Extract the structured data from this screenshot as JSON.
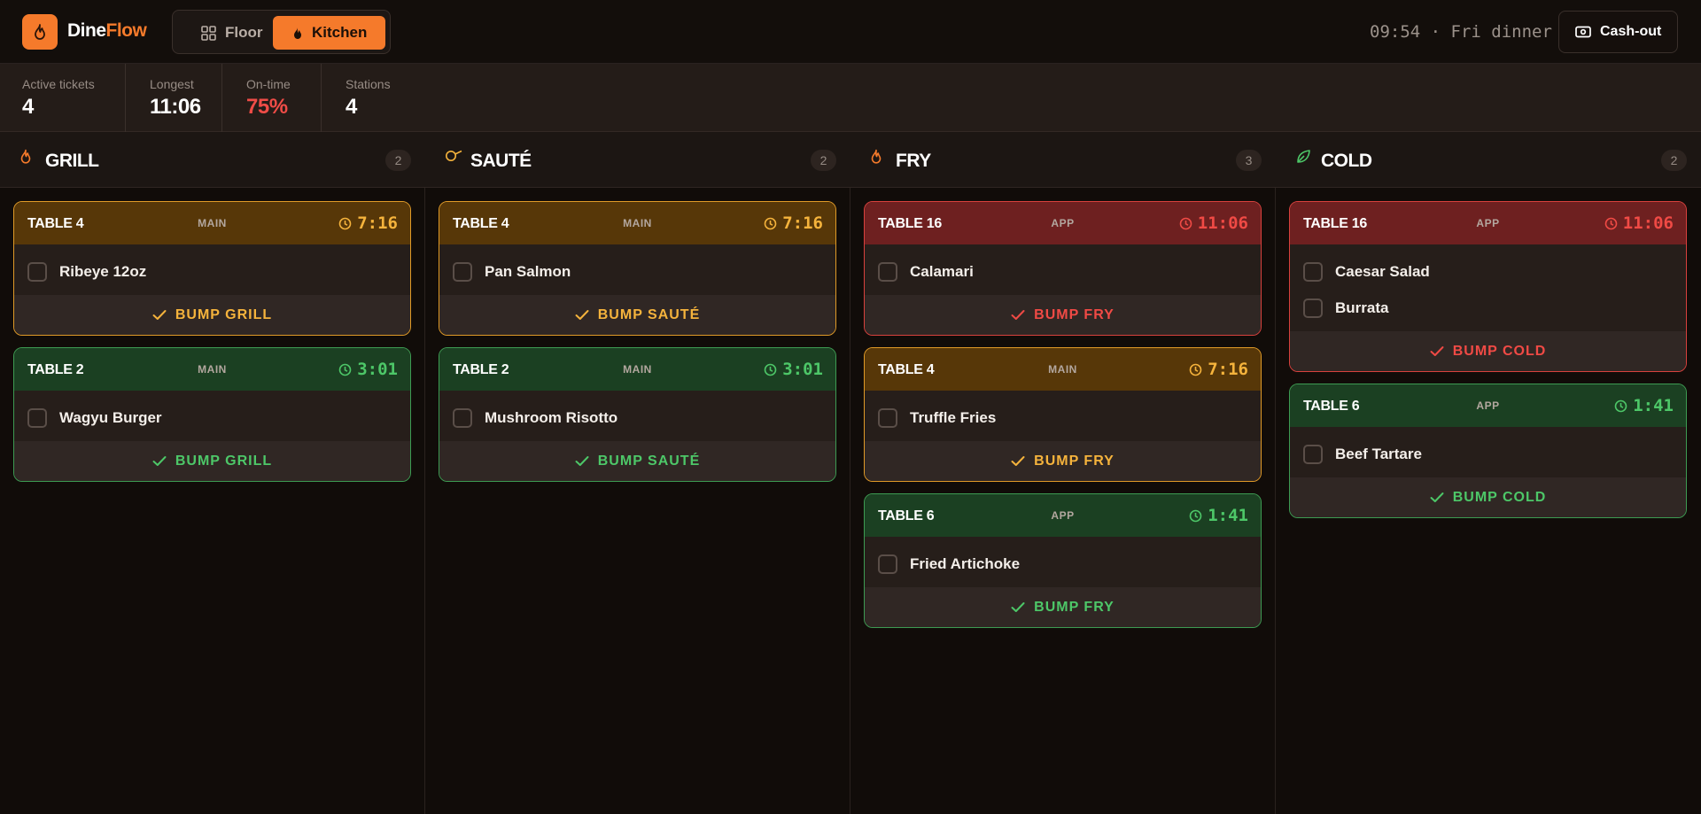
{
  "brand": {
    "name_a": "Dine",
    "name_b": "Flow"
  },
  "nav": {
    "floor_label": "Floor",
    "kitchen_label": "Kitchen"
  },
  "header": {
    "clock": "09:54 · Fri dinner",
    "cashout_label": "Cash-out"
  },
  "stats": {
    "active_label": "Active tickets",
    "active_value": "4",
    "longest_label": "Longest",
    "longest_value": "11:06",
    "ontime_label": "On-time",
    "ontime_value": "75%",
    "stations_label": "Stations",
    "stations_value": "4"
  },
  "colors": {
    "accent": "#f57a2b",
    "warn": "#f5b33c",
    "late": "#f04a45",
    "ok": "#4dc768"
  },
  "columns": [
    {
      "title": "GRILL",
      "count": "2",
      "icon": "flame-icon",
      "tickets": [
        {
          "table": "TABLE 4",
          "course": "MAIN",
          "time": "7:16",
          "status": "warn",
          "items": [
            "Ribeye 12oz"
          ],
          "bump": "BUMP GRILL"
        },
        {
          "table": "TABLE 2",
          "course": "MAIN",
          "time": "3:01",
          "status": "ok",
          "items": [
            "Wagyu Burger"
          ],
          "bump": "BUMP GRILL"
        }
      ]
    },
    {
      "title": "SAUTÉ",
      "count": "2",
      "icon": "pan-icon",
      "tickets": [
        {
          "table": "TABLE 4",
          "course": "MAIN",
          "time": "7:16",
          "status": "warn",
          "items": [
            "Pan Salmon"
          ],
          "bump": "BUMP SAUTÉ"
        },
        {
          "table": "TABLE 2",
          "course": "MAIN",
          "time": "3:01",
          "status": "ok",
          "items": [
            "Mushroom Risotto"
          ],
          "bump": "BUMP SAUTÉ"
        }
      ]
    },
    {
      "title": "FRY",
      "count": "3",
      "icon": "flame-icon",
      "tickets": [
        {
          "table": "TABLE 16",
          "course": "APP",
          "time": "11:06",
          "status": "late",
          "items": [
            "Calamari"
          ],
          "bump": "BUMP FRY"
        },
        {
          "table": "TABLE 4",
          "course": "MAIN",
          "time": "7:16",
          "status": "warn",
          "items": [
            "Truffle Fries"
          ],
          "bump": "BUMP FRY"
        },
        {
          "table": "TABLE 6",
          "course": "APP",
          "time": "1:41",
          "status": "ok",
          "items": [
            "Fried Artichoke"
          ],
          "bump": "BUMP FRY"
        }
      ]
    },
    {
      "title": "COLD",
      "count": "2",
      "icon": "leaf-icon",
      "tickets": [
        {
          "table": "TABLE 16",
          "course": "APP",
          "time": "11:06",
          "status": "late",
          "items": [
            "Caesar Salad",
            "Burrata"
          ],
          "bump": "BUMP COLD"
        },
        {
          "table": "TABLE 6",
          "course": "APP",
          "time": "1:41",
          "status": "ok",
          "items": [
            "Beef Tartare"
          ],
          "bump": "BUMP COLD"
        }
      ]
    }
  ]
}
